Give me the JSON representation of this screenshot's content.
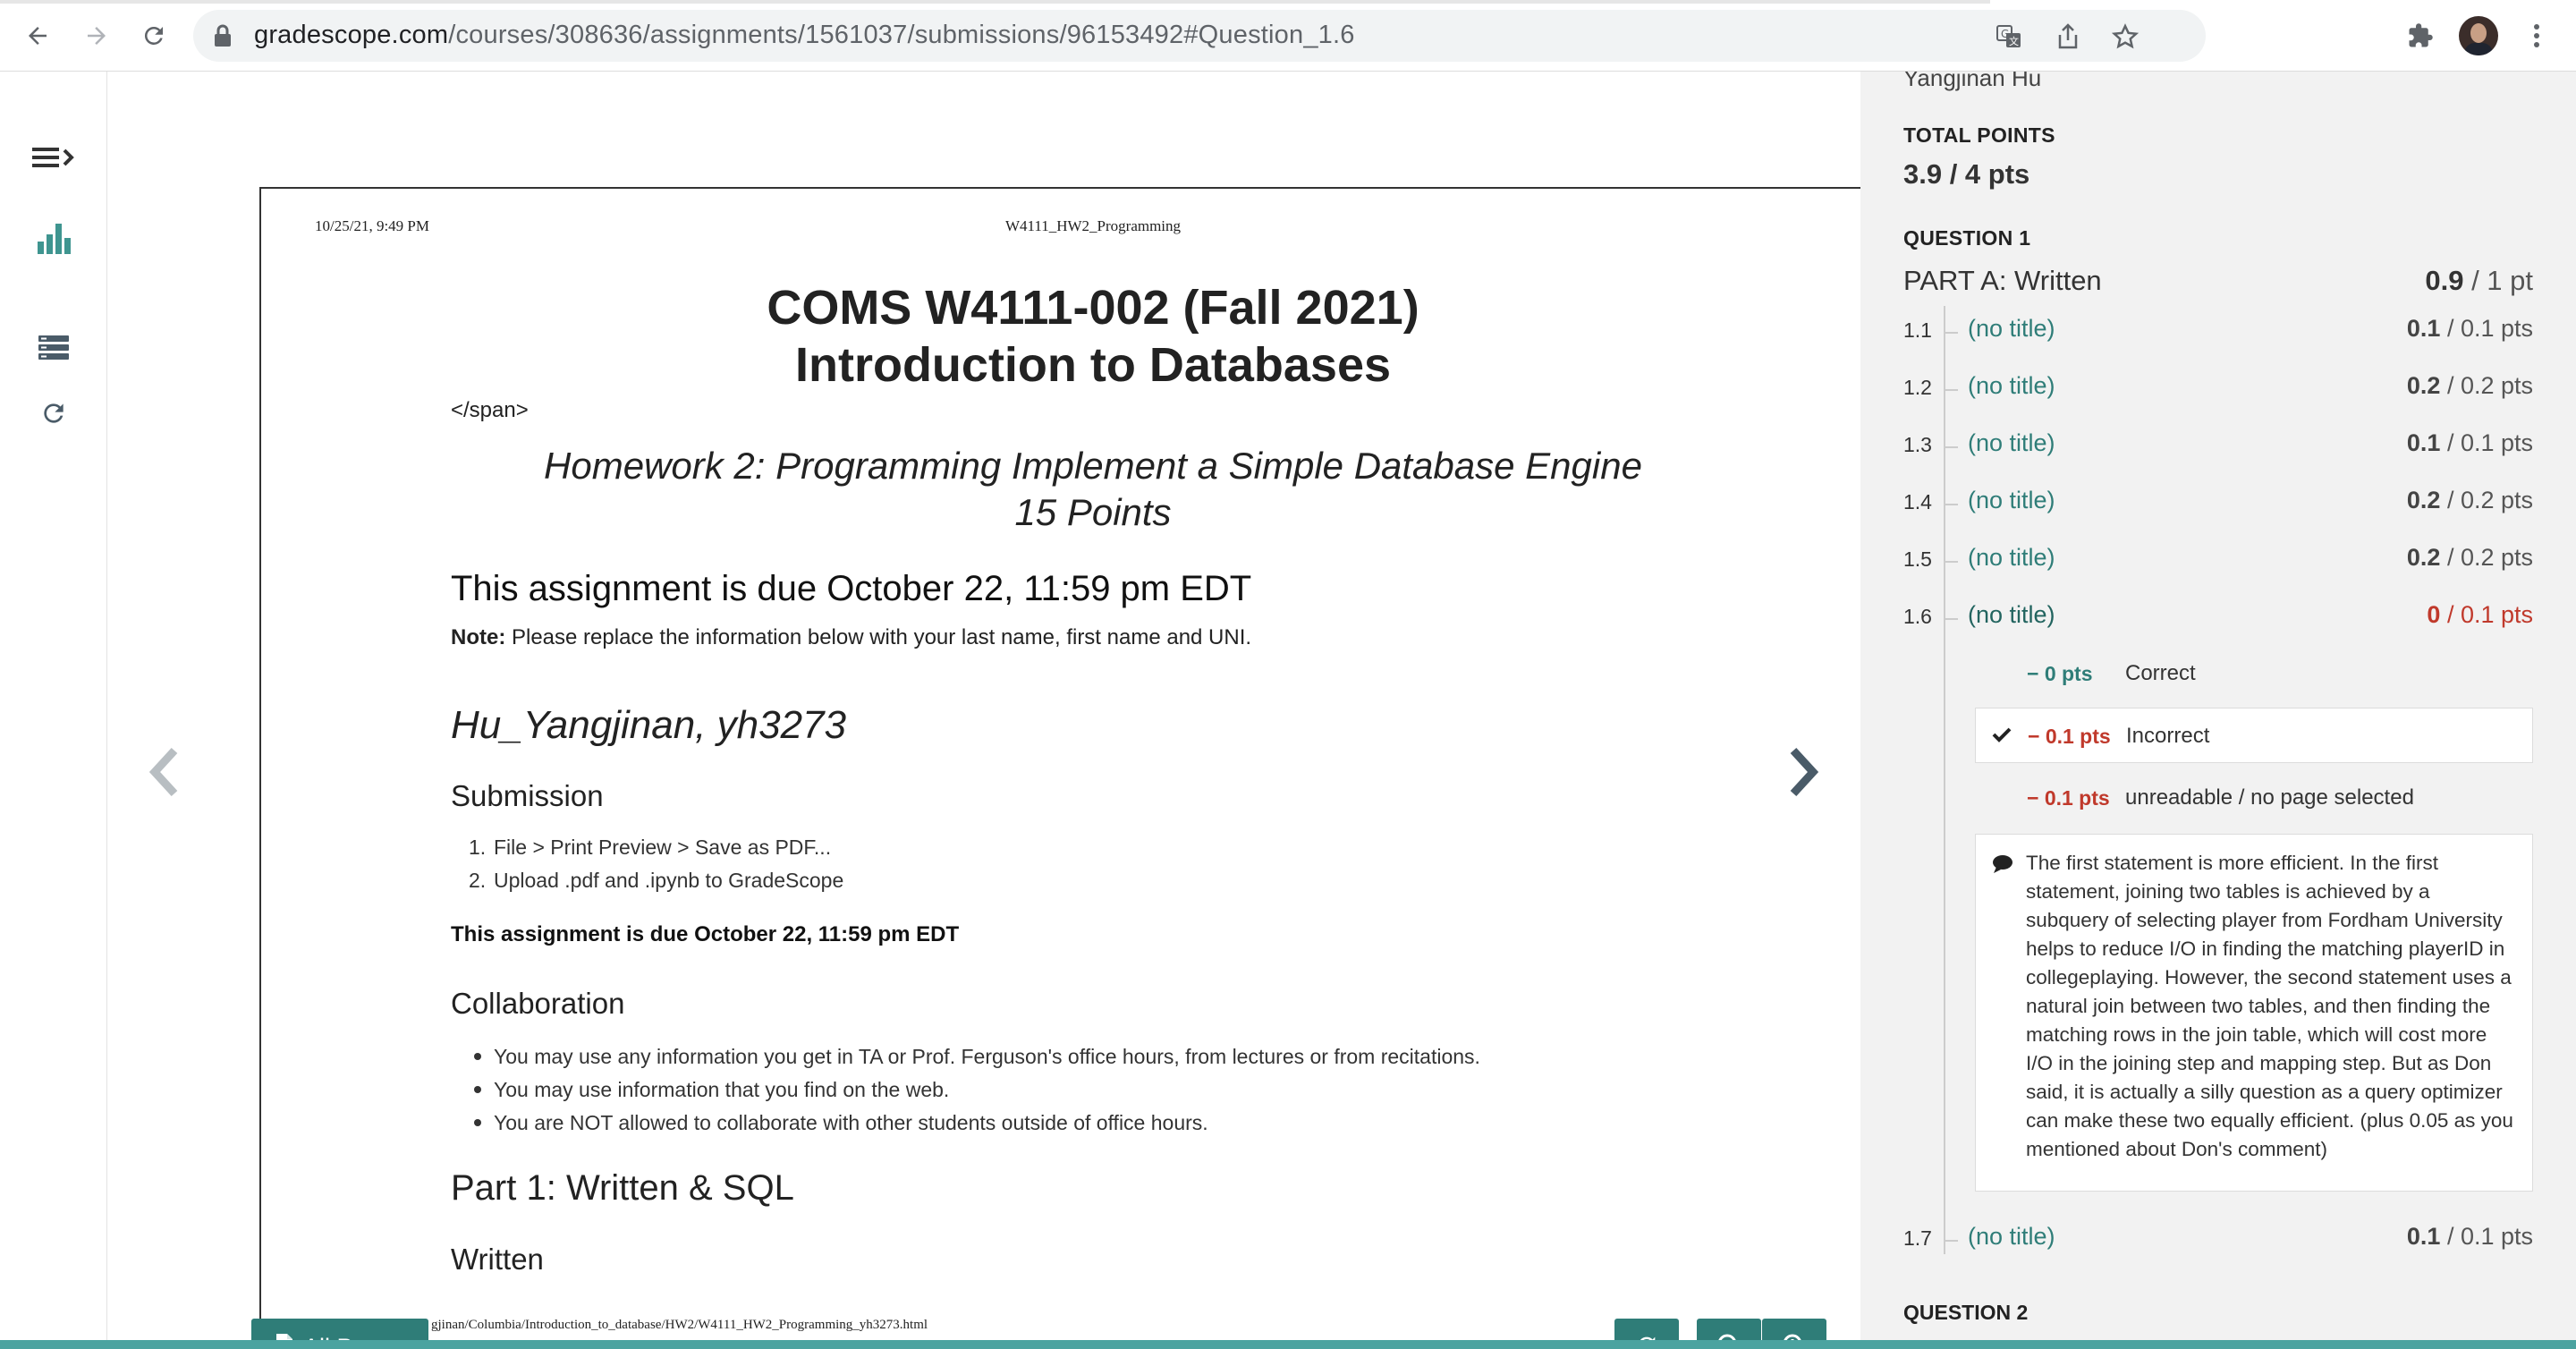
{
  "browser": {
    "url_host": "gradescope.com",
    "url_path": "/courses/308636/assignments/1561037/submissions/96153492#Question_1.6"
  },
  "document": {
    "header_date": "10/25/21, 9:49 PM",
    "header_title": "W4111_HW2_Programming",
    "course_title_line1": "COMS W4111-002 (Fall 2021)",
    "course_title_line2": "Introduction to Databases",
    "span_tag": "</span>",
    "hw_title_line1": "Homework 2: Programming Implement a Simple Database Engine",
    "hw_title_line2": "15 Points",
    "due_heading": "This assignment is due October 22, 11:59 pm EDT",
    "note_label": "Note:",
    "note_text": " Please replace the information below with your last name, first name and UNI.",
    "student_line": "Hu_Yangjinan, yh3273",
    "submission_heading": "Submission",
    "submission_steps": [
      {
        "num": "1.",
        "text": "File > Print Preview > Save as PDF..."
      },
      {
        "num": "2.",
        "text": "Upload .pdf and .ipynb to GradeScope"
      }
    ],
    "due_bold": "This assignment is due October 22, 11:59 pm EDT",
    "collab_heading": "Collaboration",
    "collab_items": [
      "You may use any information you get in TA or Prof. Ferguson's office hours, from lectures or from recitations.",
      "You may use information that you find on the web.",
      "You are NOT allowed to collaborate with other students outside of office hours."
    ],
    "part1_heading": "Part 1: Written & SQL",
    "written_heading": "Written",
    "footer_path": "gjinan/Columbia/Introduction_to_database/HW2/W4111_HW2_Programming_yh3273.html"
  },
  "viewer": {
    "all_pages_label": "All Pages"
  },
  "panel": {
    "student_name": "Yangjinan Hu",
    "total_points_label": "TOTAL POINTS",
    "total_points_value": "3.9 / 4 pts",
    "question1_label": "QUESTION 1",
    "part_title": "PART A: Written",
    "part_score": "0.9",
    "part_max": " / 1 pt",
    "questions": [
      {
        "num": "1.1",
        "title": "(no title)",
        "score": "0.1",
        "max": " / 0.1 pts"
      },
      {
        "num": "1.2",
        "title": "(no title)",
        "score": "0.2",
        "max": " / 0.2 pts"
      },
      {
        "num": "1.3",
        "title": "(no title)",
        "score": "0.1",
        "max": " / 0.1 pts"
      },
      {
        "num": "1.4",
        "title": "(no title)",
        "score": "0.2",
        "max": " / 0.2 pts"
      },
      {
        "num": "1.5",
        "title": "(no title)",
        "score": "0.2",
        "max": " / 0.2 pts"
      },
      {
        "num": "1.6",
        "title": "(no title)",
        "score": "0",
        "max": " / 0.1 pts"
      },
      {
        "num": "1.7",
        "title": "(no title)",
        "score": "0.1",
        "max": " / 0.1 pts"
      }
    ],
    "rubric": [
      {
        "pts": "− 0 pts",
        "desc": "Correct",
        "color": "#2f7d78"
      },
      {
        "pts": "− 0.1 pts",
        "desc": "Incorrect",
        "color": "#c0392b"
      },
      {
        "pts": "− 0.1 pts",
        "desc": "unreadable / no page selected",
        "color": "#c0392b"
      }
    ],
    "comment": "The first statement is more efficient. In the first statement, joining two tables is achieved by a subquery of selecting player from Fordham University helps to reduce I/O in finding the matching playerID in collegeplaying. However, the second statement uses a natural join between two tables, and then finding the matching rows in the join table, which will cost more I/O in the joining step and mapping step. But as Don said, it is actually a silly question as a query optimizer can make these two equally efficient. (plus 0.05 as you mentioned about Don's comment)",
    "question2_label": "QUESTION 2"
  },
  "colors": {
    "accent": "#2f7d78",
    "deduction": "#c0392b",
    "bottom_bar": "#4ba3a0"
  },
  "icons": [
    "back-arrow-icon",
    "forward-arrow-icon",
    "reload-icon",
    "lock-icon",
    "translate-icon",
    "share-icon",
    "star-icon",
    "extensions-icon",
    "kebab-menu-icon",
    "menu-expand-icon",
    "bar-chart-icon",
    "list-icon",
    "refresh-icon",
    "chevron-left-icon",
    "chevron-right-icon",
    "file-icon",
    "rotate-icon",
    "zoom-out-icon",
    "zoom-in-icon",
    "checkmark-icon",
    "comment-icon"
  ]
}
